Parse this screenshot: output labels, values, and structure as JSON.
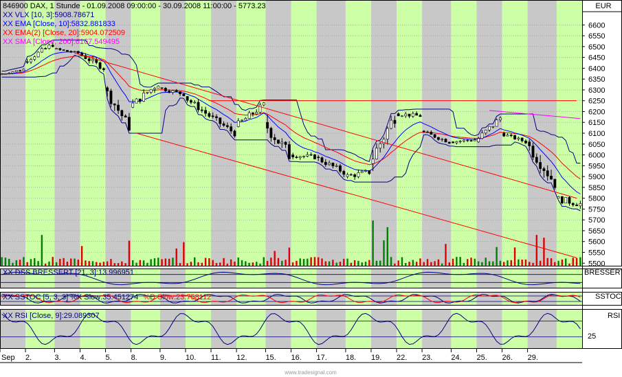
{
  "chart_data": {
    "type": "candlestick",
    "title": "846900  DAX, 1 Stunde - 01.09.2008 09:00:00 - 30.09.2008 11:00:00 - 5773.23",
    "currency": "EUR",
    "footer": "www.tradesignal.com",
    "main_axis": {
      "ylim": [
        5485,
        6715
      ],
      "ticks": [
        5500,
        5550,
        5600,
        5650,
        5700,
        5750,
        5800,
        5850,
        5900,
        5950,
        6000,
        6050,
        6100,
        6150,
        6200,
        6250,
        6300,
        6350,
        6400,
        6450,
        6500,
        6550,
        6600
      ]
    },
    "x_labels": [
      "Sep",
      "2.",
      "3.",
      "4.",
      "5.",
      "8.",
      "9.",
      "10.",
      "11.",
      "12.",
      "15.",
      "16.",
      "17.",
      "18.",
      "19.",
      "22.",
      "23.",
      "24.",
      "25.",
      "26.",
      "29."
    ],
    "legend": [
      {
        "text": "XX VLX [10, 3]:5908.78671",
        "color": "#000080"
      },
      {
        "text": "XX EMA [Close, 10]:5832.881833",
        "color": "#0000ff"
      },
      {
        "text": "XX EMA(2) [Close, 20]:5904.072509",
        "color": "#ff0000"
      },
      {
        "text": "XX SMA [Close, 200]:6167.549495",
        "color": "#ff00ff"
      }
    ],
    "anchors": {
      "days": [
        {
          "label": "1",
          "high": 6400,
          "low": 6360,
          "open": 6370,
          "close": 6395
        },
        {
          "label": "2",
          "high": 6530,
          "low": 6420,
          "open": 6430,
          "close": 6510
        },
        {
          "label": "3",
          "high": 6500,
          "low": 6450,
          "open": 6490,
          "close": 6470
        },
        {
          "label": "4",
          "high": 6490,
          "low": 6380,
          "open": 6470,
          "close": 6400
        },
        {
          "label": "5",
          "high": 6320,
          "low": 6110,
          "open": 6310,
          "close": 6130
        },
        {
          "label": "8",
          "high": 6350,
          "low": 6200,
          "open": 6220,
          "close": 6330
        },
        {
          "label": "9",
          "high": 6320,
          "low": 6240,
          "open": 6310,
          "close": 6280
        },
        {
          "label": "10",
          "high": 6300,
          "low": 6170,
          "open": 6270,
          "close": 6180
        },
        {
          "label": "11",
          "high": 6200,
          "low": 6070,
          "open": 6180,
          "close": 6100
        },
        {
          "label": "12",
          "high": 6260,
          "low": 6120,
          "open": 6130,
          "close": 6230
        },
        {
          "label": "15",
          "high": 6230,
          "low": 5930,
          "open": 6150,
          "close": 6000
        },
        {
          "label": "16",
          "high": 6050,
          "low": 5950,
          "open": 6000,
          "close": 5990
        },
        {
          "label": "17",
          "high": 6000,
          "low": 5880,
          "open": 5990,
          "close": 5920
        },
        {
          "label": "18",
          "high": 5960,
          "low": 5840,
          "open": 5900,
          "close": 5920
        },
        {
          "label": "19",
          "high": 6220,
          "low": 5900,
          "open": 5960,
          "close": 6180
        },
        {
          "label": "22",
          "high": 6230,
          "low": 6150,
          "open": 6190,
          "close": 6180
        },
        {
          "label": "23",
          "high": 6120,
          "low": 6040,
          "open": 6110,
          "close": 6060
        },
        {
          "label": "24",
          "high": 6110,
          "low": 6040,
          "open": 6060,
          "close": 6070
        },
        {
          "label": "25",
          "high": 6190,
          "low": 6040,
          "open": 6060,
          "close": 6170
        },
        {
          "label": "26",
          "high": 6110,
          "low": 6040,
          "open": 6100,
          "close": 6060
        },
        {
          "label": "29",
          "high": 6100,
          "low": 5840,
          "open": 6060,
          "close": 5870
        },
        {
          "label": "30",
          "high": 5810,
          "low": 5670,
          "open": 5800,
          "close": 5773.23
        }
      ]
    },
    "trend_lines": [
      {
        "name": "upper-channel",
        "from": {
          "bar": 20,
          "value": 6470
        },
        "to": {
          "bar": 158,
          "value": 5800
        }
      },
      {
        "name": "lower-channel",
        "from": {
          "bar": 37,
          "value": 6100
        },
        "to": {
          "bar": 158,
          "value": 5525
        }
      },
      {
        "name": "resistance",
        "from": {
          "bar": 57,
          "value": 6250
        },
        "to": {
          "bar": 158,
          "value": 6250
        }
      }
    ],
    "subpanels": [
      {
        "name": "dss",
        "label": "XX DSS BRESSERT [21, 3]:13.996951",
        "axis_label": "BRESSERT",
        "label_color": "#000080"
      },
      {
        "name": "sstoc",
        "label": "XX SSTOC [5, 3, 3] %K Slow:35.451274",
        "label2": "%D Slow:23.758112",
        "axis_label": "SSTOC",
        "label_color": "#000080",
        "label2_color": "#ff0000"
      },
      {
        "name": "rsi",
        "label": "XX RSI [Close, 9]:29.089307",
        "axis_label": "RSI",
        "tick": "25",
        "label_color": "#000080"
      }
    ]
  }
}
